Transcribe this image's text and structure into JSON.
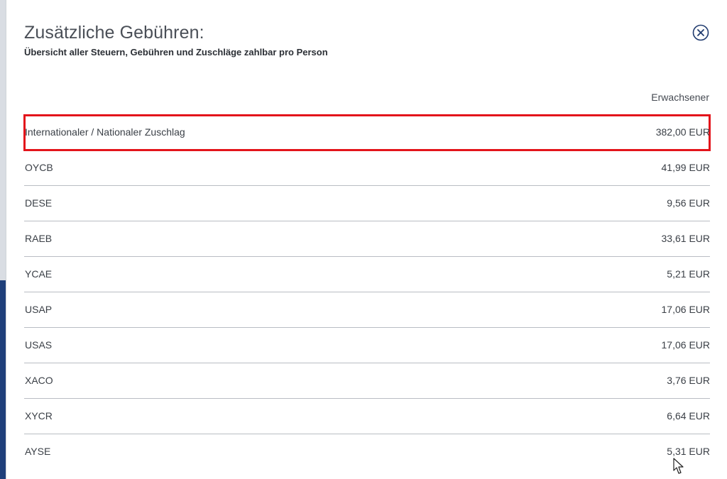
{
  "modal": {
    "title": "Zusätzliche Gebühren:",
    "subtitle": "Übersicht aller Steuern, Gebühren und Zuschläge zahlbar pro Person",
    "close_icon": "circle-x-icon"
  },
  "table": {
    "column_header": "Erwachsener",
    "rows": [
      {
        "label": "Internationaler / Nationaler Zuschlag",
        "amount": "382,00 EUR",
        "highlighted": true
      },
      {
        "label": "OYCB",
        "amount": "41,99 EUR"
      },
      {
        "label": "DESE",
        "amount": "9,56 EUR"
      },
      {
        "label": "RAEB",
        "amount": "33,61 EUR"
      },
      {
        "label": "YCAE",
        "amount": "5,21 EUR"
      },
      {
        "label": "USAP",
        "amount": "17,06 EUR"
      },
      {
        "label": "USAS",
        "amount": "17,06 EUR"
      },
      {
        "label": "XACO",
        "amount": "3,76 EUR"
      },
      {
        "label": "XYCR",
        "amount": "6,64 EUR"
      },
      {
        "label": "AYSE",
        "amount": "5,31 EUR"
      }
    ]
  },
  "colors": {
    "highlight": "#e3141b",
    "close_icon": "#1f3a6e",
    "text": "#3a3f46"
  }
}
